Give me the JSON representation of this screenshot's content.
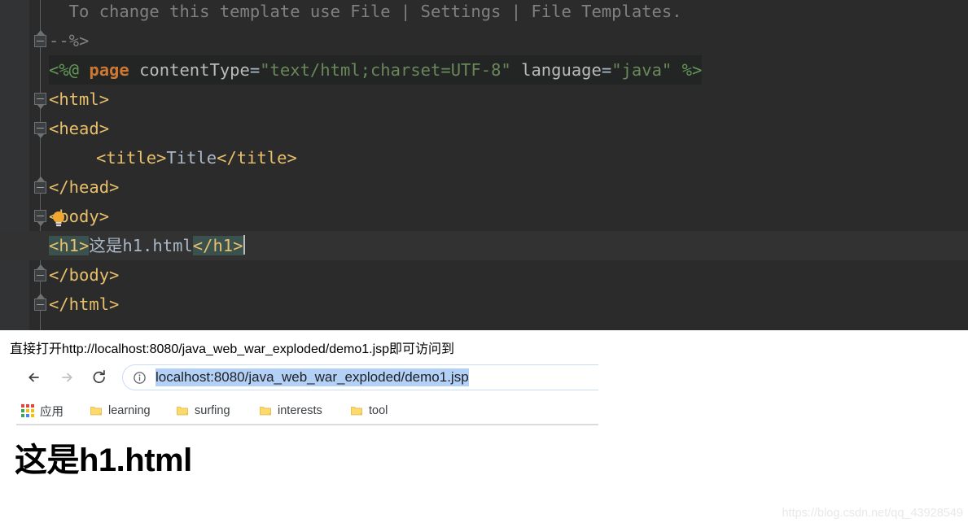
{
  "editor": {
    "theme_name": "darcula",
    "background": "#2b2b2b",
    "gutter_background": "#313335",
    "current_line_background": "#323232",
    "matched_tag_highlight": "#3b514d",
    "lines": [
      {
        "id": "comment-tail",
        "text": "  To change this template use File | Settings | File Templates."
      },
      {
        "id": "comment-close",
        "text": "--%>"
      },
      {
        "id": "jsp-directive",
        "text": "<%@ page contentType=\"text/html;charset=UTF-8\" language=\"java\" %>"
      },
      {
        "id": "html-open",
        "text": "<html>"
      },
      {
        "id": "head-open",
        "text": "<head>"
      },
      {
        "id": "title",
        "text": "    <title>Title</title>"
      },
      {
        "id": "head-close",
        "text": "</head>"
      },
      {
        "id": "body-open",
        "text": "<body>"
      },
      {
        "id": "h1-line",
        "text": "<h1>这是h1.html</h1>"
      },
      {
        "id": "body-close",
        "text": "</body>"
      },
      {
        "id": "html-close",
        "text": "</html>"
      }
    ],
    "tokens": {
      "comment_text": "  To change this template use File | Settings | File Templates.",
      "comment_close": "--%>",
      "jsp_open": "<%@",
      "jsp_keyword": "page",
      "attr_contenttype": "contentType",
      "val_contenttype": "\"text/html;charset=UTF-8\"",
      "attr_language": "language",
      "val_language": "\"java\"",
      "jsp_close": "%>",
      "tag_html_open": "<html>",
      "tag_head_open": "<head>",
      "tag_title_open": "<title>",
      "title_text": "Title",
      "tag_title_close": "</title>",
      "tag_head_close": "</head>",
      "tag_body_open": "<body>",
      "tag_h1_open": "<h1>",
      "h1_text": "这是h1.html",
      "tag_h1_close": "</h1>",
      "tag_body_close": "</body>",
      "tag_html_close": "</html>"
    },
    "icons": {
      "intention_bulb": "lightbulb-icon",
      "fold_collapse": "fold-collapse-icon"
    }
  },
  "annotation": {
    "text": "直接打开http://localhost:8080/java_web_war_exploded/demo1.jsp即可访问到"
  },
  "browser": {
    "nav": {
      "back_icon": "arrow-left-icon",
      "forward_icon": "arrow-right-icon",
      "reload_icon": "reload-icon",
      "back_enabled": true,
      "forward_enabled": false
    },
    "omnibox": {
      "security_icon": "info-circle-icon",
      "url": "localhost:8080/java_web_war_exploded/demo1.jsp",
      "selected": true,
      "selection_color": "#b3d0f7"
    },
    "bookmarks": [
      {
        "icon": "apps-grid-icon",
        "label": "应用"
      },
      {
        "icon": "folder-icon",
        "label": "learning"
      },
      {
        "icon": "folder-icon",
        "label": "surfing"
      },
      {
        "icon": "folder-icon",
        "label": "interests"
      },
      {
        "icon": "folder-icon",
        "label": "tool"
      }
    ],
    "apps_icon_colors": [
      "#ea4335",
      "#ea4335",
      "#ea4335",
      "#34a853",
      "#fbbc05",
      "#fbbc05",
      "#34a853",
      "#4285f4",
      "#fbbc05"
    ],
    "folder_color": "#fbd96b",
    "page": {
      "heading": "这是h1.html"
    }
  },
  "watermark": {
    "text": "https://blog.csdn.net/qq_43928549"
  }
}
